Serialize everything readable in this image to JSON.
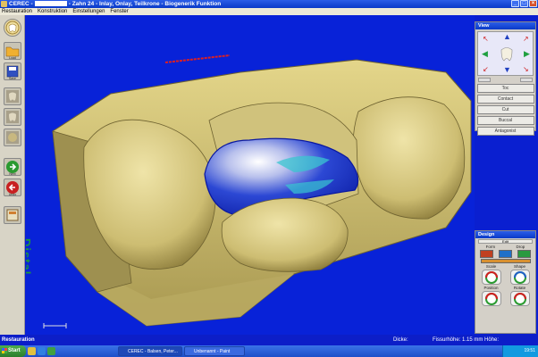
{
  "window": {
    "title_prefix": "CEREC -",
    "title_suffix": "- Zahn 24 - Inlay, Onlay, Teilkrone - Biogenerik Funktion",
    "min_label": "_",
    "max_label": "□",
    "close_label": "×"
  },
  "menu": {
    "items": [
      "Restauration",
      "Konstruktion",
      "Einstellungen",
      "Fenster"
    ]
  },
  "sidebar": {
    "buttons": [
      {
        "icon": "tooth-logo-icon",
        "label": ""
      },
      {
        "icon": "folder-open-icon",
        "label": "Load"
      },
      {
        "icon": "save-icon",
        "label": "Save"
      },
      {
        "icon": "tooth-stage-icon",
        "label": ""
      },
      {
        "icon": "tooth-stage-icon",
        "label": ""
      },
      {
        "icon": "tooth-stage-icon",
        "label": ""
      },
      {
        "icon": "next-arrow-icon",
        "label": "Next"
      },
      {
        "icon": "undo-icon",
        "label": "Undo"
      },
      {
        "icon": "calc-icon",
        "label": ""
      }
    ]
  },
  "viewport": {
    "orientation_label": "Distal"
  },
  "view_panel": {
    "title": "View",
    "buttons": [
      "Toc",
      "Contact",
      "Cut",
      "Buccal",
      "Antagonist"
    ]
  },
  "design_panel": {
    "title": "Design",
    "edit_label": "Edit",
    "row1": [
      "Form",
      "Drop"
    ],
    "tools": [
      "Scale",
      "Shape",
      "Position",
      "Rotate"
    ]
  },
  "status": {
    "left": "Restauration",
    "dicke_label": "Dicke:",
    "flow": "Fissurhöhe: 1.15 mm Höhe:"
  },
  "taskbar": {
    "start_label": "Start",
    "tasks": [
      "CEREC - Balsen, Peter...",
      "Unbenannt - Paint"
    ],
    "clock": "19:51"
  },
  "colors": {
    "background": "#0822d8",
    "tooth": "#d8c97a",
    "preparation": "#1a34c8"
  }
}
